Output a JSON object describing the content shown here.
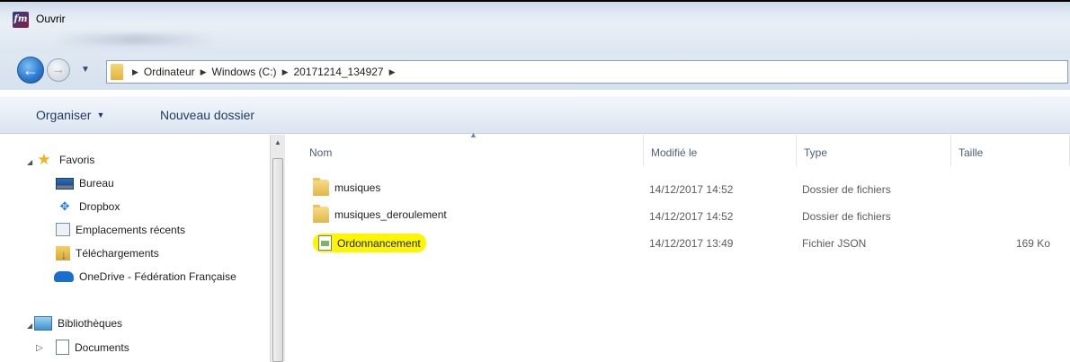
{
  "window": {
    "title": "Ouvrir",
    "app_icon_glyph": "fm"
  },
  "nav": {
    "back_icon": "back-arrow-icon",
    "forward_icon": "forward-arrow-icon",
    "breadcrumbs": [
      "Ordinateur",
      "Windows (C:)",
      "20171214_134927"
    ]
  },
  "toolbar": {
    "organise_label": "Organiser",
    "new_folder_label": "Nouveau dossier"
  },
  "sidebar": {
    "favorites_label": "Favoris",
    "favorites": [
      {
        "label": "Bureau",
        "icon": "desktop-icon"
      },
      {
        "label": "Dropbox",
        "icon": "dropbox-icon"
      },
      {
        "label": "Emplacements récents",
        "icon": "recent-places-icon"
      },
      {
        "label": "Téléchargements",
        "icon": "downloads-icon"
      },
      {
        "label": "OneDrive - Fédération Française",
        "icon": "onedrive-icon"
      }
    ],
    "libraries_label": "Bibliothèques",
    "libraries": [
      {
        "label": "Documents",
        "icon": "documents-icon"
      }
    ]
  },
  "columns": {
    "name": "Nom",
    "modified": "Modifié le",
    "type": "Type",
    "size": "Taille"
  },
  "files": [
    {
      "name": "musiques",
      "modified": "14/12/2017 14:52",
      "type": "Dossier de fichiers",
      "size": "",
      "icon": "folder-icon"
    },
    {
      "name": "musiques_deroulement",
      "modified": "14/12/2017 14:52",
      "type": "Dossier de fichiers",
      "size": "",
      "icon": "folder-icon"
    },
    {
      "name": "Ordonnancement",
      "modified": "14/12/2017 13:49",
      "type": "Fichier JSON",
      "size": "169 Ko",
      "icon": "json-file-icon",
      "highlight": "#fdf600"
    }
  ]
}
